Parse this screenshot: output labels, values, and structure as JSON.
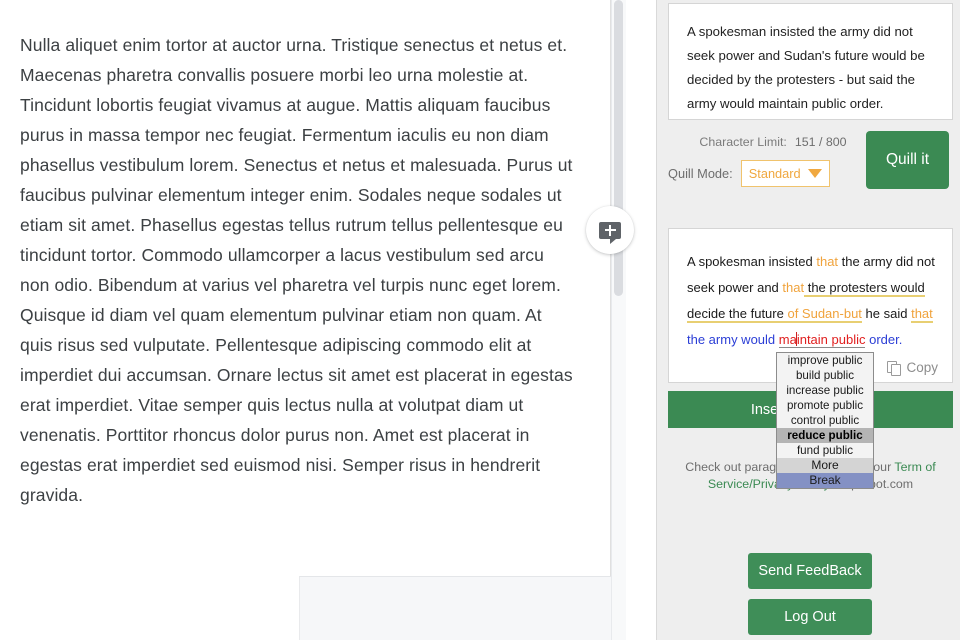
{
  "document": {
    "body_text": "Nulla aliquet enim tortor at auctor urna. Tristique senectus et netus et. Maecenas pharetra convallis posuere morbi leo urna molestie at. Tincidunt lobortis feugiat vivamus at augue. Mattis aliquam faucibus purus in massa tempor nec feugiat. Fermentum iaculis eu non diam phasellus vestibulum lorem. Senectus et netus et malesuada. Purus ut faucibus pulvinar elementum integer enim. Sodales neque sodales ut etiam sit amet. Phasellus egestas tellus rutrum tellus pellentesque eu tincidunt tortor. Commodo ullamcorper a lacus vestibulum sed arcu non odio. Bibendum at varius vel pharetra vel turpis nunc eget lorem. Quisque id diam vel quam elementum pulvinar etiam non quam. At quis risus sed vulputate. Pellentesque adipiscing commodo elit at imperdiet dui accumsan. Ornare lectus sit amet est placerat in egestas erat imperdiet. Vitae semper quis lectus nulla at volutpat diam ut venenatis. Porttitor rhoncus dolor purus non. Amet est placerat in egestas erat imperdiet sed euismod nisi. Semper risus in hendrerit gravida.",
    "comment_button_icon": "add-comment-icon"
  },
  "sidebar": {
    "input": {
      "value": "A spokesman insisted the army did not seek power and Sudan's future would be decided by the protesters - but said the army would maintain public order."
    },
    "character_limit": {
      "label": "Character Limit:",
      "value": "151 / 800",
      "used": 151,
      "max": 800
    },
    "quill_mode": {
      "label": "Quill Mode:",
      "selected": "Standard",
      "caret_icon": "chevron-down-icon"
    },
    "quill_it_button": "Quill it",
    "output": {
      "segments": [
        {
          "text": "A spokesman insisted ",
          "color": "default",
          "underline": "none"
        },
        {
          "text": "that",
          "color": "orange",
          "underline": "none"
        },
        {
          "text": " the army did not seek power and ",
          "color": "default",
          "underline": "none"
        },
        {
          "text": "that",
          "color": "orange",
          "underline": "none"
        },
        {
          "text": " the protesters would decide the future ",
          "color": "default",
          "underline": "yellow"
        },
        {
          "text": "of Sudan-but",
          "color": "orange",
          "underline": "yellow"
        },
        {
          "text": " he said ",
          "color": "default",
          "underline": "none"
        },
        {
          "text": "that",
          "color": "orange",
          "underline": "yellow"
        },
        {
          "text": " the army would ",
          "color": "blue",
          "underline": "none"
        },
        {
          "text": "maintain public",
          "color": "red",
          "underline": "gray"
        },
        {
          "text": " order.",
          "color": "blue",
          "underline": "none"
        }
      ],
      "plain_text": "A spokesman insisted that the army did not seek power and that the protesters would decide the future of Sudan-but he said that the army would maintain public order.",
      "copy_label": "Copy",
      "copy_icon": "copy-icon"
    },
    "insert_button": "Insert in document",
    "footer": {
      "line1_prefix": "Check out paragraph",
      "line1_mid": " rewriter and our ",
      "link_part1": "Term of Service",
      "separator": "/",
      "link_part2": "Privacy Policy",
      "line2_suffix": " at quillbot.com"
    },
    "send_feedback_button": "Send FeedBack",
    "log_out_button": "Log Out"
  },
  "suggestion_menu": {
    "items": [
      {
        "label": "improve public",
        "state": "normal"
      },
      {
        "label": "build public",
        "state": "normal"
      },
      {
        "label": "increase public",
        "state": "normal"
      },
      {
        "label": "promote public",
        "state": "normal"
      },
      {
        "label": "control public",
        "state": "normal"
      },
      {
        "label": "reduce public",
        "state": "selected"
      },
      {
        "label": "fund public",
        "state": "normal"
      }
    ],
    "actions": [
      {
        "label": "More",
        "state": "normal"
      },
      {
        "label": "Break",
        "state": "highlight"
      }
    ]
  },
  "colors": {
    "accent_green": "#3b8a53",
    "orange": "#f0a33c",
    "blue": "#2b3ed6",
    "red": "#e02020",
    "underline_yellow": "#e8cf72",
    "sidebar_bg": "#eeeeee",
    "selected_gray": "#b4b4b4",
    "highlight_blue": "#8491c4"
  }
}
